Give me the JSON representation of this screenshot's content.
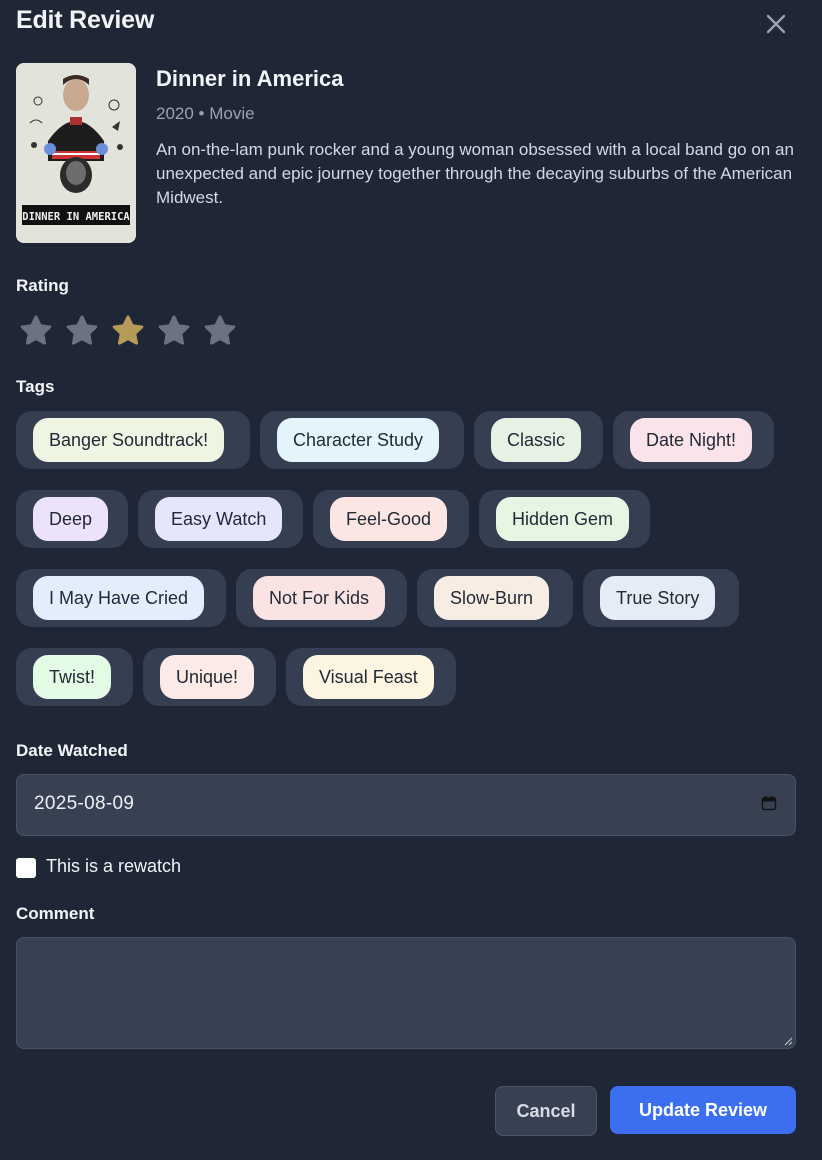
{
  "dialog": {
    "title": "Edit Review",
    "close_icon": "close-icon"
  },
  "movie": {
    "title": "Dinner in America",
    "meta": "2020 • Movie",
    "description": "An on-the-lam punk rocker and a young woman obsessed with a local band go on an unexpected and epic journey together through the decaying suburbs of the American Midwest.",
    "poster_text": "DINNER IN AMERICA"
  },
  "rating": {
    "label": "Rating",
    "value": 3,
    "max": 5,
    "active_color": "#b59a58",
    "inactive_color": "#6b7280"
  },
  "tags": {
    "label": "Tags",
    "items": [
      {
        "label": "Banger Soundtrack!",
        "color": "#eef5e3"
      },
      {
        "label": "Character Study",
        "color": "#e4f4fb"
      },
      {
        "label": "Classic",
        "color": "#e7f1e4"
      },
      {
        "label": "Date Night!",
        "color": "#fbe3ea"
      },
      {
        "label": "Deep",
        "color": "#ece3fb"
      },
      {
        "label": "Easy Watch",
        "color": "#e5e6fb"
      },
      {
        "label": "Feel-Good",
        "color": "#fbe6e3"
      },
      {
        "label": "Hidden Gem",
        "color": "#e5f6e3"
      },
      {
        "label": "I May Have Cried",
        "color": "#e4edfb"
      },
      {
        "label": "Not For Kids",
        "color": "#fae3e3"
      },
      {
        "label": "Slow-Burn",
        "color": "#f8ede3"
      },
      {
        "label": "True Story",
        "color": "#e5ecf7"
      },
      {
        "label": "Twist!",
        "color": "#e3fae5"
      },
      {
        "label": "Unique!",
        "color": "#fbeae5"
      },
      {
        "label": "Visual Feast",
        "color": "#fbf5e1"
      }
    ]
  },
  "date_watched": {
    "label": "Date Watched",
    "value": "2025-08-09",
    "icon": "calendar-icon"
  },
  "rewatch": {
    "label": "This is a rewatch",
    "checked": false
  },
  "comment": {
    "label": "Comment",
    "value": ""
  },
  "actions": {
    "cancel_label": "Cancel",
    "submit_label": "Update Review",
    "submit_color": "#3b6ff0"
  }
}
